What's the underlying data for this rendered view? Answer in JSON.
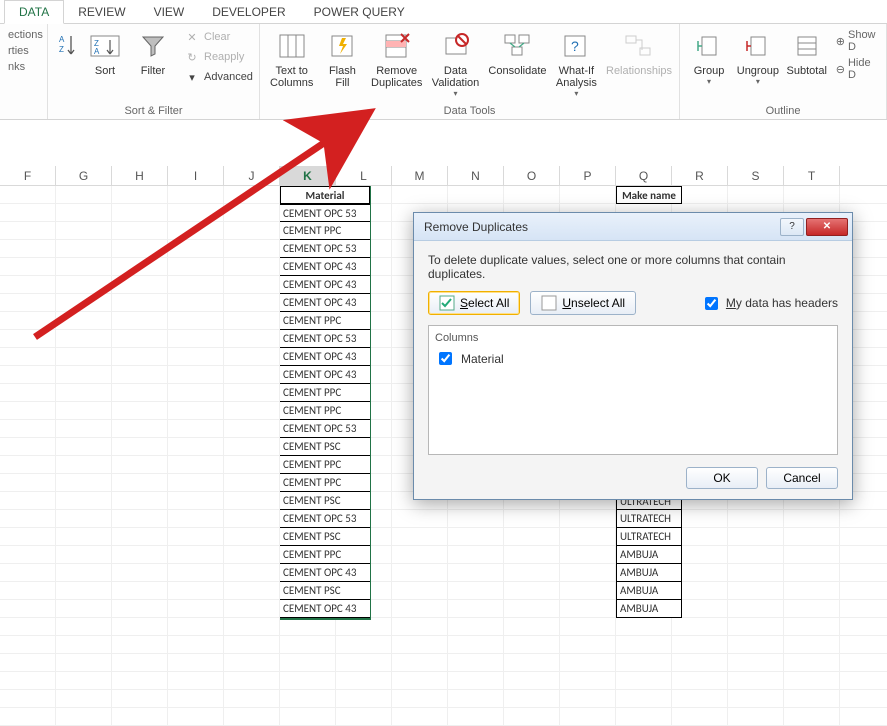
{
  "tabs": {
    "data": "DATA",
    "review": "REVIEW",
    "view": "VIEW",
    "developer": "DEVELOPER",
    "powerquery": "POWER QUERY"
  },
  "ribbon_left_misc": {
    "connections_stub": "ections",
    "properties_stub": "rties",
    "links_stub": "nks"
  },
  "sort_filter": {
    "sort": "Sort",
    "filter": "Filter",
    "clear": "Clear",
    "reapply": "Reapply",
    "advanced": "Advanced",
    "group": "Sort & Filter"
  },
  "data_tools": {
    "text_to_columns": "Text to\nColumns",
    "flash_fill": "Flash\nFill",
    "remove_duplicates": "Remove\nDuplicates",
    "data_validation": "Data\nValidation",
    "consolidate": "Consolidate",
    "whatif": "What-If\nAnalysis",
    "relationships": "Relationships",
    "group": "Data Tools"
  },
  "outline": {
    "group_btn": "Group",
    "ungroup": "Ungroup",
    "subtotal": "Subtotal",
    "group": "Outline",
    "show_detail": "Show D",
    "hide_detail": "Hide D"
  },
  "columns": [
    "F",
    "G",
    "H",
    "I",
    "J",
    "K",
    "L",
    "M",
    "N",
    "O",
    "P",
    "Q",
    "R",
    "S",
    "T"
  ],
  "headers": {
    "k": "Material",
    "p": "Make name"
  },
  "material_values": [
    "CEMENT OPC 53",
    "CEMENT PPC",
    "CEMENT OPC 53",
    "CEMENT OPC 43",
    "CEMENT OPC 43",
    "CEMENT OPC 43",
    "CEMENT PPC",
    "CEMENT OPC 53",
    "CEMENT OPC 43",
    "CEMENT OPC 43",
    "CEMENT PPC",
    "CEMENT PPC",
    "CEMENT OPC 53",
    "CEMENT PSC",
    "CEMENT PPC",
    "CEMENT PPC",
    "CEMENT PSC",
    "CEMENT OPC 53",
    "CEMENT PSC",
    "CEMENT PPC",
    "CEMENT OPC 43",
    "CEMENT PSC",
    "CEMENT OPC 43"
  ],
  "make_values_tail": [
    "ULTRATECH",
    "ULTRATECH",
    "ULTRATECH",
    "AMBUJA",
    "AMBUJA",
    "AMBUJA",
    "AMBUJA"
  ],
  "dialog": {
    "title": "Remove Duplicates",
    "instruction": "To delete duplicate values, select one or more columns that contain duplicates.",
    "select_all": "Select All",
    "unselect_all": "Unselect All",
    "headers_checkbox": "My data has headers",
    "columns_label": "Columns",
    "column_item": "Material",
    "ok": "OK",
    "cancel": "Cancel"
  }
}
